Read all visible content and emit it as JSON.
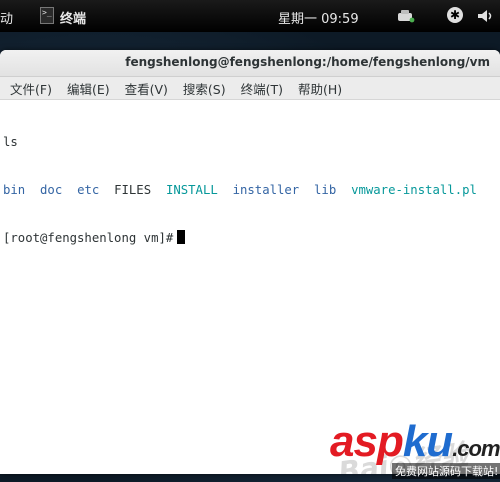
{
  "panel": {
    "activities_label": "动",
    "app_icon_glyph": ">_",
    "app_name": "终端",
    "clock": "星期一 09:59",
    "a11y_glyph": "✱"
  },
  "window": {
    "title": "fengshenlong@fengshenlong:/home/fengshenlong/vm",
    "menu": [
      "文件(F)",
      "编辑(E)",
      "查看(V)",
      "搜索(S)",
      "终端(T)",
      "帮助(H)"
    ]
  },
  "terminal": {
    "command": "ls",
    "listing": [
      {
        "name": "bin",
        "kind": "dir"
      },
      {
        "name": "doc",
        "kind": "dir"
      },
      {
        "name": "etc",
        "kind": "dir"
      },
      {
        "name": "FILES",
        "kind": "file"
      },
      {
        "name": "INSTALL",
        "kind": "exec"
      },
      {
        "name": "installer",
        "kind": "dir"
      },
      {
        "name": "lib",
        "kind": "dir"
      },
      {
        "name": "vmware-install.pl",
        "kind": "exec"
      }
    ],
    "prompt": "[root@fengshenlong vm]#"
  },
  "colors": {
    "dir": "#3465a4",
    "exec": "#06989a",
    "file": "#2e3436"
  },
  "watermark": {
    "baidu": "Bai◎经验",
    "brand_a": "asp",
    "brand_b": "ku",
    "brand_c": ".com",
    "subtitle": "免费网站源码下载站!"
  }
}
